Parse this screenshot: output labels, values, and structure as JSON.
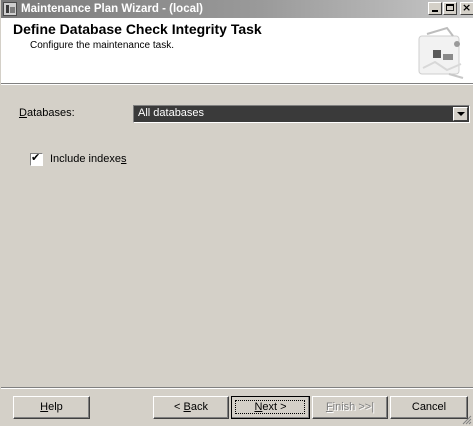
{
  "window": {
    "title": "Maintenance Plan Wizard - (local)"
  },
  "title_buttons": {
    "minimize": "_",
    "maximize": "□",
    "close": "×"
  },
  "header": {
    "title": "Define Database Check Integrity Task",
    "subtitle": "Configure the maintenance task."
  },
  "form": {
    "databases_label": "Databases:",
    "databases_label_accel": "D",
    "databases_label_rest": "atabases:",
    "databases_value": "All databases",
    "include_indexes_label_pre": "Include indexe",
    "include_indexes_label_accel": "s",
    "include_indexes_checked": true,
    "check_glyph": "✔"
  },
  "buttons": {
    "help_accel": "H",
    "help_rest": "elp",
    "back_pre": "< ",
    "back_accel": "B",
    "back_rest": "ack",
    "next_accel": "N",
    "next_rest": "ext >",
    "finish_accel": "F",
    "finish_rest": "inish >>|",
    "cancel": "Cancel"
  },
  "colors": {
    "dialog_bg": "#d4d0c8",
    "header_bg": "#ffffff",
    "combo_selected_bg": "#3a3a3a",
    "titlebar_start": "#7a7a7a"
  }
}
